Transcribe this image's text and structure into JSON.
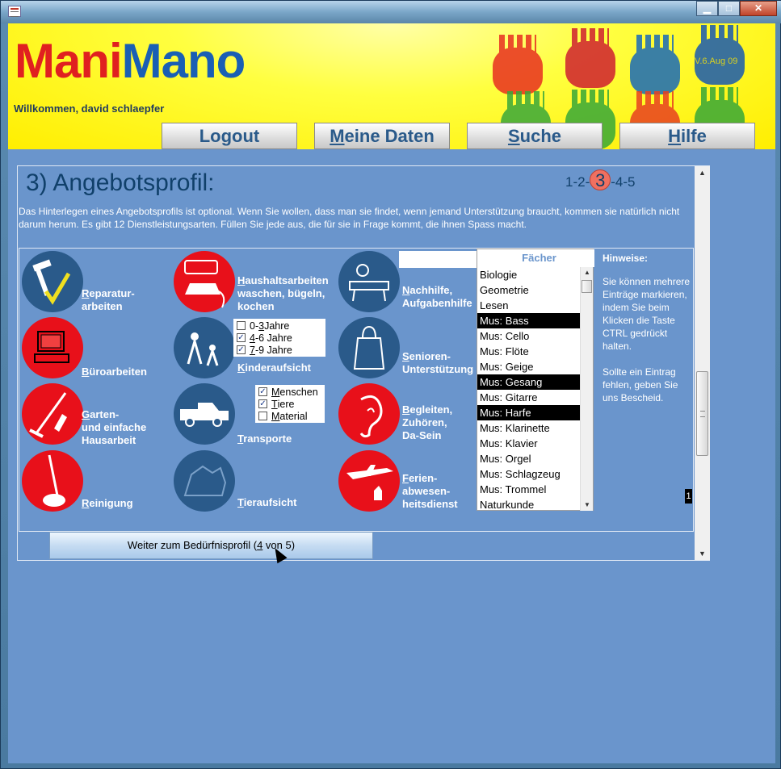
{
  "window": {
    "buttons": {
      "minimize": "▁",
      "maximize": "□",
      "close": "✕"
    }
  },
  "header": {
    "logo_part1": "Mani",
    "logo_part2": "Mano",
    "welcome": "Willkommen, david schlaepfer",
    "version": "V.6.Aug 09",
    "nav": [
      {
        "label_rest": "Logout",
        "label_key": ""
      },
      {
        "label_key": "M",
        "label_rest": "eine Daten"
      },
      {
        "label_key": "S",
        "label_rest": "uche"
      },
      {
        "label_key": "H",
        "label_rest": "ilfe"
      }
    ]
  },
  "page": {
    "title": "3) Angebotsprofil:",
    "steps_before": "1-2-",
    "step_current": "3",
    "steps_after": "-4-5",
    "intro": "Das Hinterlegen eines Angebotsprofils ist optional. Wenn Sie wollen, dass man sie findet, wenn jemand Unterstützung braucht, kommen sie natürlich nicht darum herum. Es gibt 12 Dienstleistungsarten. Füllen Sie jede aus, die für sie in Frage kommt, die ihnen Spass macht."
  },
  "services": {
    "reparatur": {
      "key": "R",
      "l1": "eparatur-",
      "l2": "arbeiten"
    },
    "buero": {
      "key": "B",
      "rest": "üroarbeiten"
    },
    "garten": {
      "key": "G",
      "l1": "arten-",
      "l2": "und einfache",
      "l3": "Hausarbeit"
    },
    "reinigung": {
      "key": "R",
      "rest": "einigung"
    },
    "haushalt": {
      "key": "H",
      "l1": "aushaltsarbeiten",
      "l2": "waschen, bügeln,",
      "l3": "kochen"
    },
    "kinder": {
      "key": "K",
      "rest": "inderaufsicht"
    },
    "transporte": {
      "key": "T",
      "rest": "ransporte"
    },
    "tier": {
      "key": "T",
      "rest": "ieraufsicht"
    },
    "nachhilfe": {
      "key": "N",
      "l1": "achhilfe,",
      "l2": "Aufgabenhilfe"
    },
    "senioren": {
      "key": "S",
      "l1": "enioren-",
      "l2": "Unterstützung"
    },
    "begleiten": {
      "key": "B",
      "l1": "egleiten,",
      "l2": "Zuhören,",
      "l3": "Da-Sein"
    },
    "ferien": {
      "key": "F",
      "l1": "erien-",
      "l2": "abwesen-",
      "l3": "heitsdienst"
    }
  },
  "kinder_options": [
    {
      "pre": "0-",
      "key": "3",
      "post": " Jahre",
      "checked": false
    },
    {
      "pre": "",
      "key": "4",
      "post": "-6 Jahre",
      "checked": true
    },
    {
      "pre": "",
      "key": "7",
      "post": "-9 Jahre",
      "checked": true
    }
  ],
  "transport_options": [
    {
      "key": "M",
      "post": "enschen",
      "checked": true
    },
    {
      "key": "T",
      "post": "iere",
      "checked": true
    },
    {
      "key": "M",
      "post": "aterial",
      "checked": false
    }
  ],
  "faecher": {
    "title": "Fächer",
    "items": [
      {
        "label": "Biologie",
        "selected": false
      },
      {
        "label": "Geometrie",
        "selected": false
      },
      {
        "label": "Lesen",
        "selected": false
      },
      {
        "label": "Mus: Bass",
        "selected": true
      },
      {
        "label": "Mus: Cello",
        "selected": false
      },
      {
        "label": "Mus: Flöte",
        "selected": false
      },
      {
        "label": "Mus: Geige",
        "selected": false
      },
      {
        "label": "Mus: Gesang",
        "selected": true
      },
      {
        "label": "Mus: Gitarre",
        "selected": false
      },
      {
        "label": "Mus: Harfe",
        "selected": true
      },
      {
        "label": "Mus: Klarinette",
        "selected": false
      },
      {
        "label": "Mus: Klavier",
        "selected": false
      },
      {
        "label": "Mus: Orgel",
        "selected": false
      },
      {
        "label": "Mus: Schlagzeug",
        "selected": false
      },
      {
        "label": "Mus: Trommel",
        "selected": false
      },
      {
        "label": "Naturkunde",
        "selected": false
      }
    ]
  },
  "hints": {
    "title": "Hinweise:",
    "p1": "Sie können mehrere Einträge markieren, indem Sie beim Klicken die Taste CTRL gedrückt halten.",
    "p2": "Sollte ein Eintrag fehlen, geben Sie uns Bescheid."
  },
  "counter": "1",
  "next_button": {
    "pre": "Weiter zum Bedürfnisprofil (",
    "key": "4",
    "post": " von 5)"
  },
  "colors": {
    "red": "#e8101a",
    "blue": "#2a5a8a",
    "background": "#6a95cc",
    "banner": "#ffee00"
  }
}
